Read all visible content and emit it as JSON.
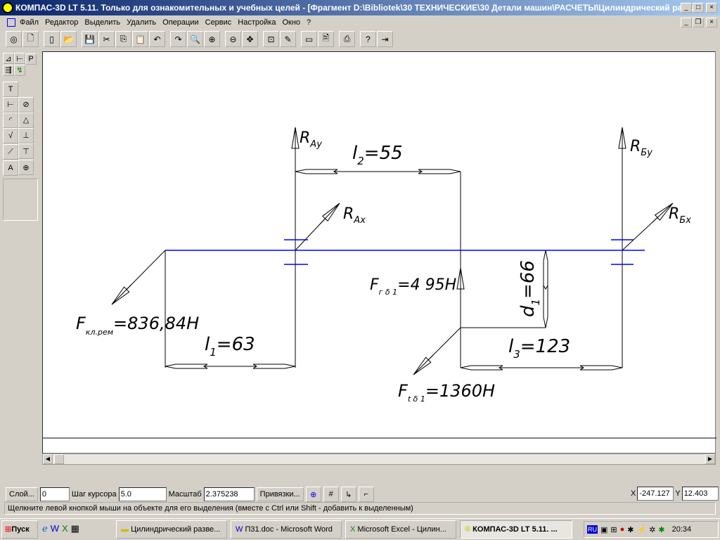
{
  "window": {
    "title": "КОМПАС-3D LT 5.11. Только для ознакомительных и учебных целей - [Фрагмент D:\\Bibliotek\\30 ТЕХНИЧЕСКИЕ\\30 Детали машин\\РАСЧЕТЫ\\Цилиндрический раз..."
  },
  "menu": [
    "Файл",
    "Редактор",
    "Выделить",
    "Удалить",
    "Операции",
    "Сервис",
    "Настройка",
    "Окно",
    "?"
  ],
  "toolbar_icons": [
    "camera-icon",
    "new-doc-icon",
    "new-fragment-icon",
    "open-icon",
    "save-icon",
    "cut-icon",
    "copy-icon",
    "paste-icon",
    "undo-icon",
    "redo-icon",
    "zoom-icon",
    "zoom-in-icon",
    "zoom-out-icon",
    "pan-icon",
    "fit-icon",
    "pencil-icon",
    "view-icon",
    "preview-icon",
    "print-icon",
    "help-icon",
    "exit-icon"
  ],
  "drawing": {
    "RAy": {
      "main": "R",
      "sub": "Ay"
    },
    "RBy": {
      "main": "R",
      "sub": "Бy"
    },
    "RAx": {
      "main": "R",
      "sub": "Ax"
    },
    "RBx": {
      "main": "R",
      "sub": "Бx"
    },
    "l2": {
      "main": "l",
      "sub": "2",
      "value": "=55"
    },
    "l1": {
      "main": "l",
      "sub": "1",
      "value": "=63"
    },
    "l3": {
      "main": "l",
      "sub": "3",
      "value": "=123"
    },
    "d1": {
      "main": "d",
      "sub": "1",
      "value": "=66"
    },
    "Fkl": {
      "main": "F",
      "sub": "кл.рем",
      "value": "=836,84H"
    },
    "Fr": {
      "main": "F",
      "sub": "г δ 1",
      "value": "=4 95H"
    },
    "Ft": {
      "main": "F",
      "sub": "t δ 1",
      "value": "=1360H"
    }
  },
  "status": {
    "layer_btn": "Слой...",
    "layer": "0",
    "step_label": "Шаг курсора",
    "step": "5.0",
    "scale_label": "Масштаб",
    "scale": "2.375238",
    "snap_btn": "Привязки...",
    "x_label": "X",
    "x": "-247.127",
    "y_label": "Y",
    "y": "12.403",
    "hint": "Щелкните левой кнопкой мыши на объекте для его выделения (вместе с Ctrl или Shift - добавить к выделенным)"
  },
  "taskbar": {
    "start": "Пуск",
    "tasks": [
      "Цилиндрический разве...",
      "П31.doc - Microsoft Word",
      "Microsoft Excel - Цилин...",
      "КОМПАС-3D LT 5.11. ..."
    ],
    "lang": "RU",
    "clock": "20:34"
  },
  "colors": {
    "shaft": "#0000ff",
    "title": "#0a246a"
  }
}
